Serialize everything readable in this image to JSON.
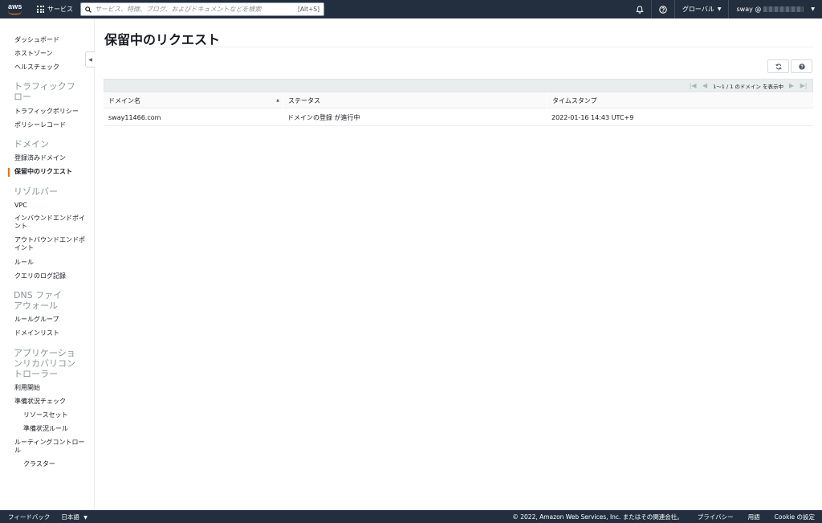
{
  "topnav": {
    "logo_text": "aws",
    "services_label": "サービス",
    "search_placeholder": "サービス、特徴、ブログ、およびドキュメントなどを検索",
    "search_shortcut": "[Alt+S]",
    "region_label": "グローバル",
    "account_label": "sway @"
  },
  "sidebar": {
    "items": [
      {
        "label": "ダッシュボード"
      },
      {
        "label": "ホストゾーン"
      },
      {
        "label": "ヘルスチェック"
      },
      {
        "label": "トラフィックフロー"
      },
      {
        "label": "トラフィックポリシー"
      },
      {
        "label": "ポリシーレコード"
      },
      {
        "label": "ドメイン"
      },
      {
        "label": "登録済みドメイン"
      },
      {
        "label": "保留中のリクエスト"
      },
      {
        "label": "リゾルバー"
      },
      {
        "label": "VPC"
      },
      {
        "label": "インバウンドエンドポイント"
      },
      {
        "label": "アウトバウンドエンドポイント"
      },
      {
        "label": "ルール"
      },
      {
        "label": "クエリのログ記録"
      },
      {
        "label": "DNS ファイアウォール"
      },
      {
        "label": "ルールグループ"
      },
      {
        "label": "ドメインリスト"
      },
      {
        "label": "アプリケーションリカバリコントローラー"
      },
      {
        "label": "利用開始"
      },
      {
        "label": "準備状況チェック"
      },
      {
        "label": "リソースセット"
      },
      {
        "label": "準備状況ルール"
      },
      {
        "label": "ルーティングコントロール"
      },
      {
        "label": "クラスター"
      }
    ]
  },
  "main": {
    "title": "保留中のリクエスト",
    "pagination_text": "1～1 / 1 のドメイン を表示中",
    "columns": [
      "ドメイン名",
      "ステータス",
      "タイムスタンプ"
    ],
    "rows": [
      {
        "domain": "sway11466.com",
        "status": "ドメインの登録 が進行中",
        "timestamp": "2022-01-16 14:43 UTC+9"
      }
    ]
  },
  "footer": {
    "feedback": "フィードバック",
    "language": "日本語",
    "copyright": "© 2022, Amazon Web Services, Inc. またはその関連会社。",
    "privacy": "プライバシー",
    "terms": "用語",
    "cookie": "Cookie の設定"
  },
  "colors": {
    "nav_bg": "#232f3e",
    "accent": "#ec7211",
    "brand_orange": "#ff9900"
  },
  "icons": [
    "grid-icon",
    "search-icon",
    "bell-icon",
    "help-icon",
    "collapse-icon",
    "refresh-icon",
    "info-icon",
    "sort-asc-icon",
    "first-page-icon",
    "prev-page-icon",
    "next-page-icon",
    "last-page-icon"
  ]
}
